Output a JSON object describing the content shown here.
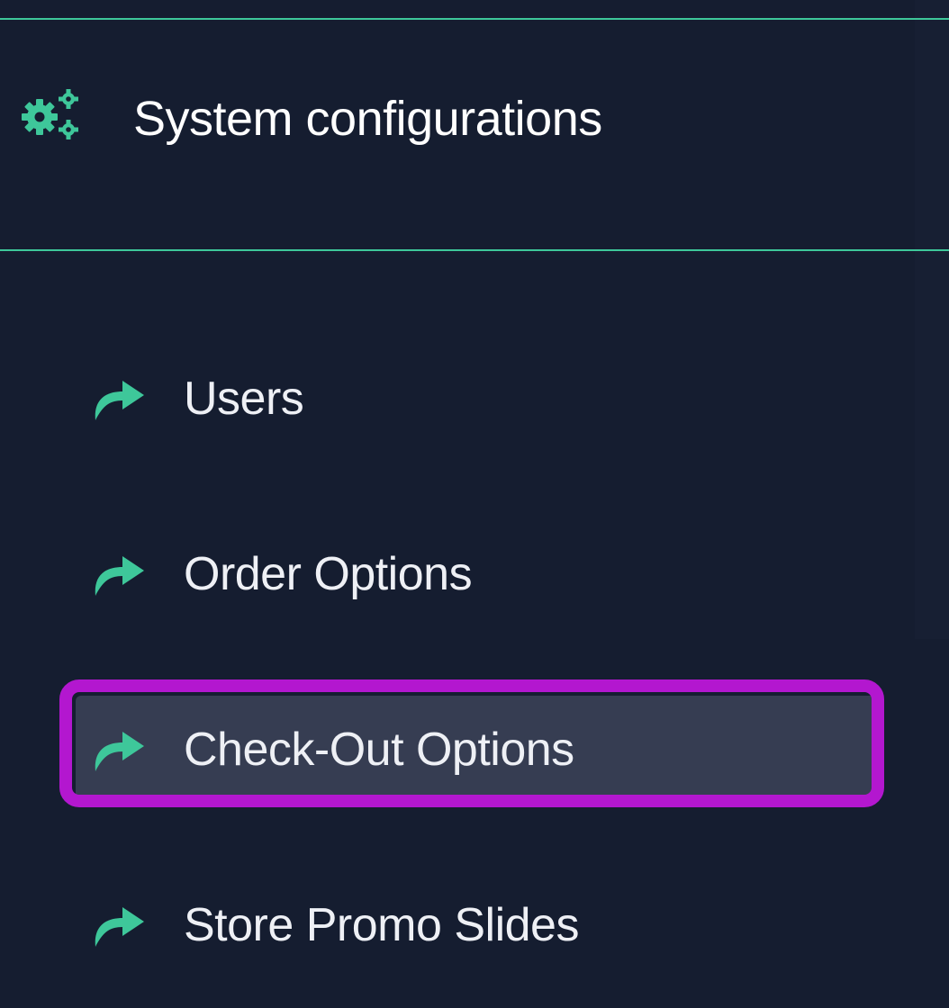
{
  "section": {
    "title": "System configurations",
    "icon": "cogs-icon"
  },
  "menu": {
    "items": [
      {
        "label": "Users",
        "icon": "share-arrow-icon",
        "active": false
      },
      {
        "label": "Order Options",
        "icon": "share-arrow-icon",
        "active": false
      },
      {
        "label": "Check-Out Options",
        "icon": "share-arrow-icon",
        "active": true
      },
      {
        "label": "Store Promo Slides",
        "icon": "share-arrow-icon",
        "active": false
      }
    ]
  },
  "colors": {
    "background": "#151d30",
    "accent": "#3ec79a",
    "active_background": "#363d52",
    "highlight_frame": "#b317cf",
    "text": "#ffffff"
  }
}
